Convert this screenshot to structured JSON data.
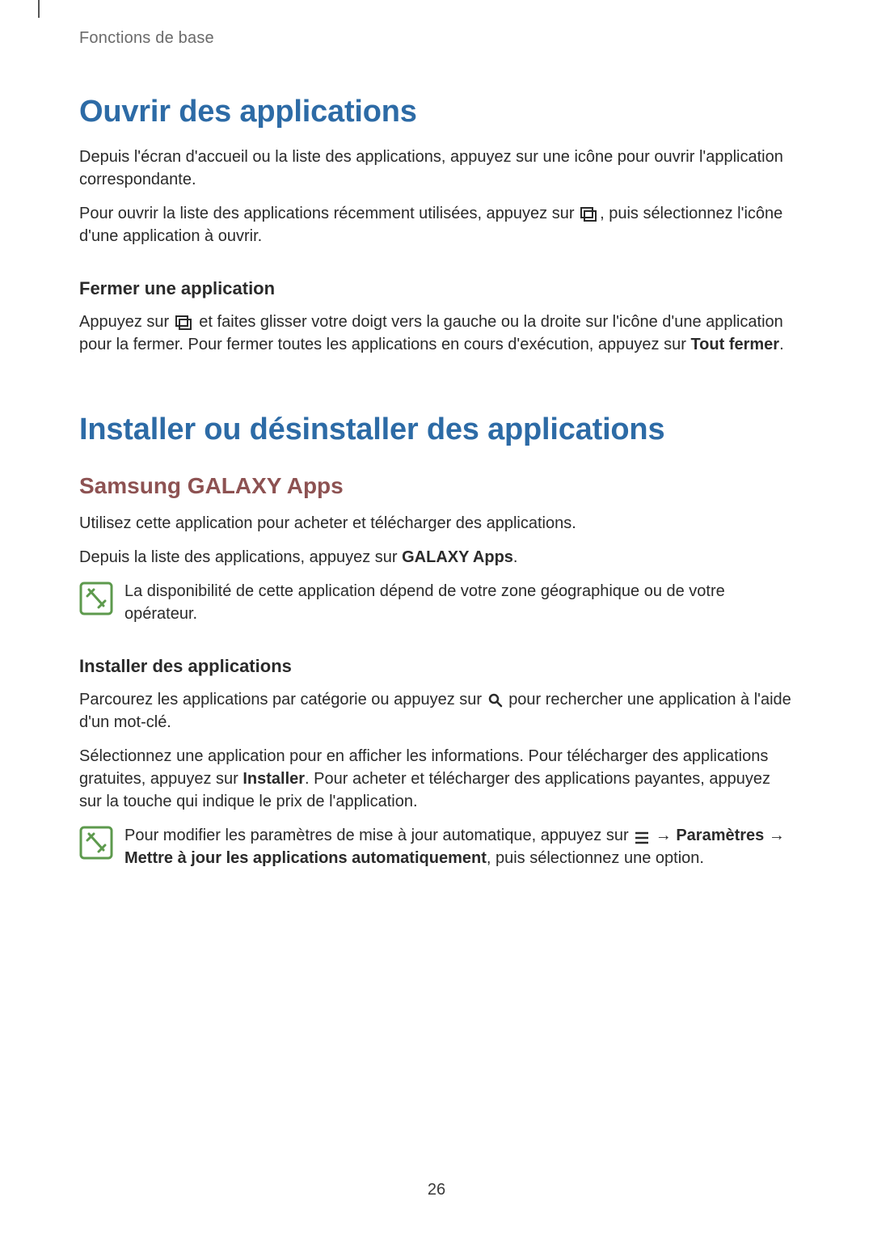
{
  "header": {
    "section": "Fonctions de base"
  },
  "sections": {
    "s1": {
      "title": "Ouvrir des applications",
      "p1_a": "Depuis l'écran d'accueil ou la liste des applications, appuyez sur une icône pour ouvrir l'application correspondante.",
      "p2_a": "Pour ouvrir la liste des applications récemment utilisées, appuyez sur ",
      "p2_b": ", puis sélectionnez l'icône d'une application à ouvrir.",
      "sub1": {
        "title": "Fermer une application",
        "p1_a": "Appuyez sur ",
        "p1_b": " et faites glisser votre doigt vers la gauche ou la droite sur l'icône d'une application pour la fermer. Pour fermer toutes les applications en cours d'exécution, appuyez sur ",
        "p1_bold": "Tout fermer",
        "p1_c": "."
      }
    },
    "s2": {
      "title": "Installer ou désinstaller des applications",
      "sub1": {
        "title": "Samsung GALAXY Apps",
        "p1": "Utilisez cette application pour acheter et télécharger des applications.",
        "p2_a": "Depuis la liste des applications, appuyez sur ",
        "p2_bold": "GALAXY Apps",
        "p2_b": ".",
        "note1": "La disponibilité de cette application dépend de votre zone géographique ou de votre opérateur."
      },
      "sub2": {
        "title": "Installer des applications",
        "p1_a": "Parcourez les applications par catégorie ou appuyez sur ",
        "p1_b": " pour rechercher une application à l'aide d'un mot-clé.",
        "p2_a": "Sélectionnez une application pour en afficher les informations. Pour télécharger des applications gratuites, appuyez sur ",
        "p2_bold": "Installer",
        "p2_b": ". Pour acheter et télécharger des applications payantes, appuyez sur la touche qui indique le prix de l'application.",
        "note2_a": "Pour modifier les paramètres de mise à jour automatique, appuyez sur ",
        "note2_arrow1": " → ",
        "note2_bold1": "Paramètres",
        "note2_arrow2": " → ",
        "note2_bold2": "Mettre à jour les applications automatiquement",
        "note2_b": ", puis sélectionnez une option."
      }
    }
  },
  "page_number": "26",
  "icons": {
    "recent_apps": "recent-apps-icon",
    "search": "search-icon",
    "menu": "menu-icon",
    "note": "note-icon"
  }
}
